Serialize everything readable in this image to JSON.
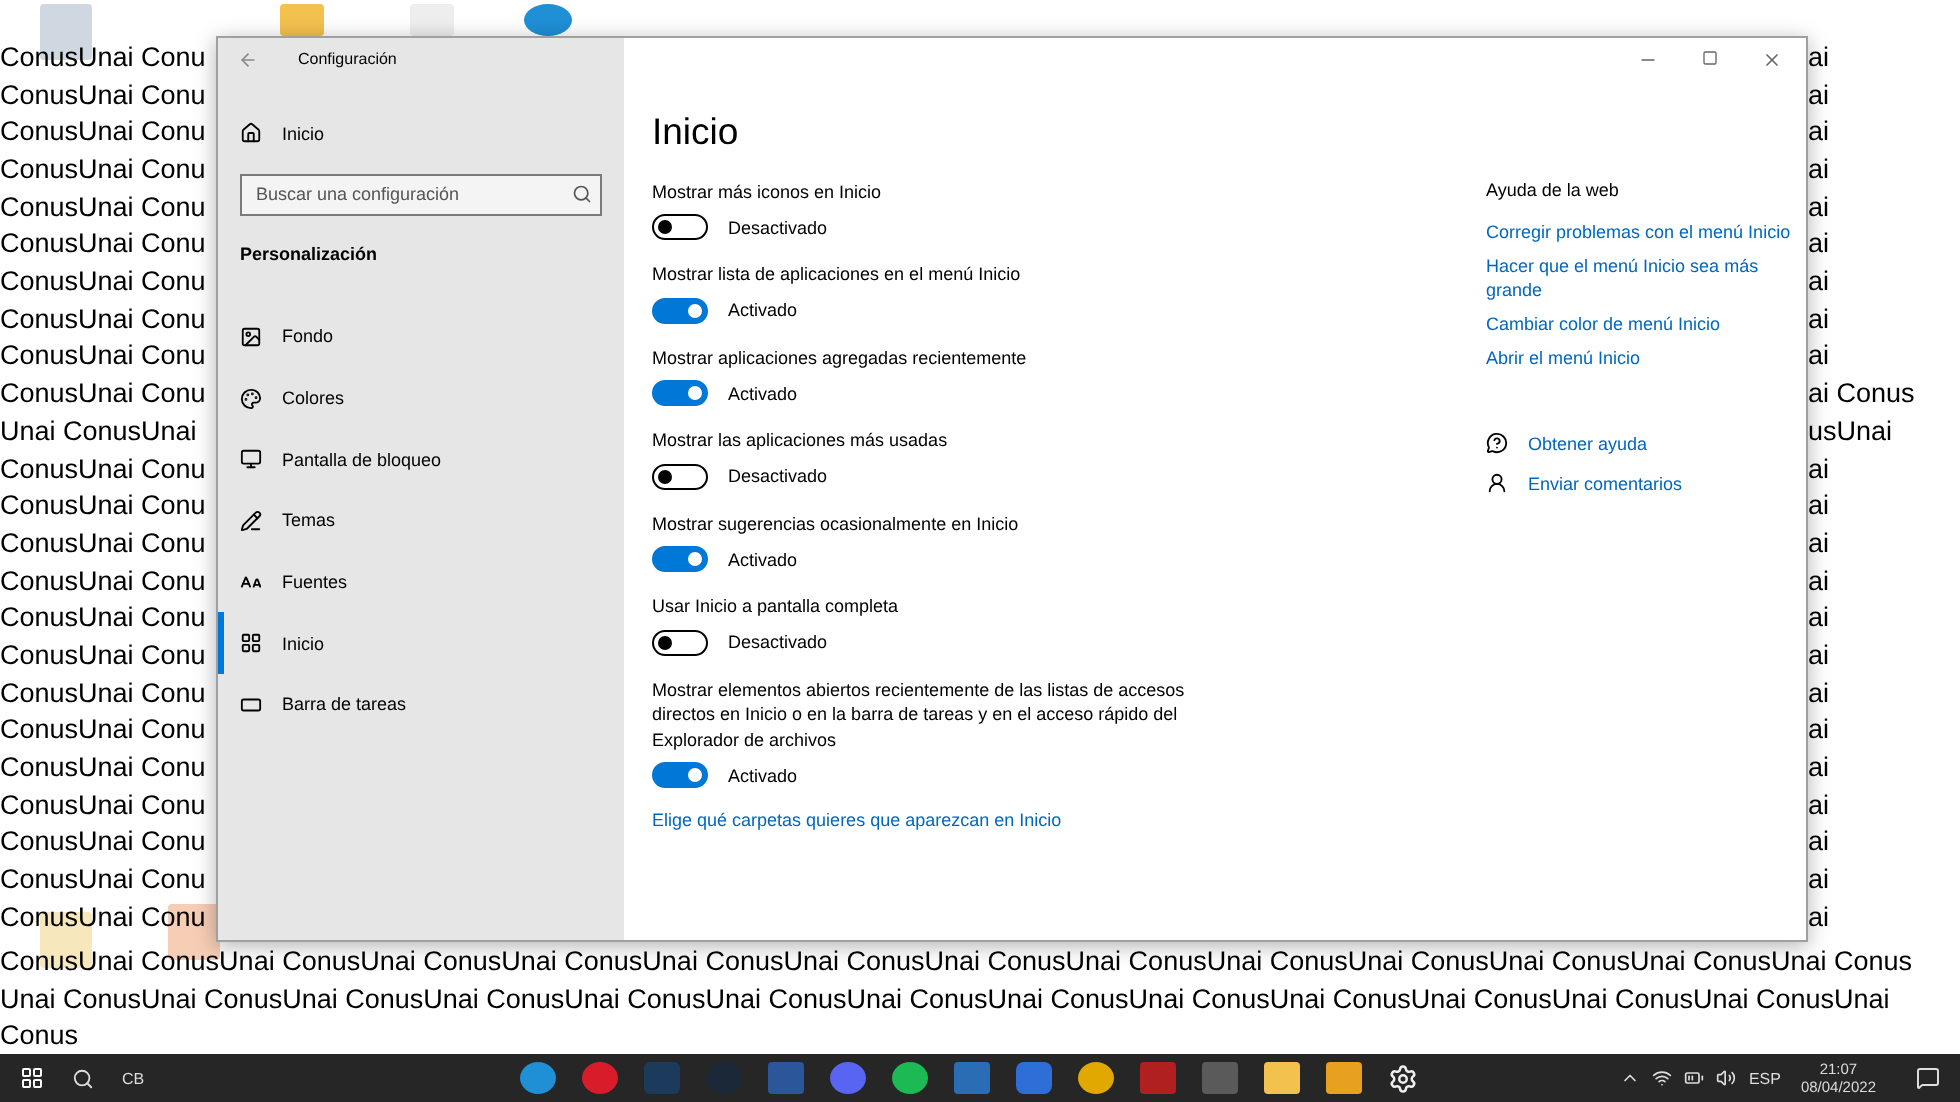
{
  "window": {
    "title": "Configuración"
  },
  "nav": {
    "home": "Inicio",
    "search": {
      "placeholder": "Buscar una configuración"
    },
    "section": "Personalización",
    "items": [
      {
        "label": "Fondo",
        "selected": false
      },
      {
        "label": "Colores",
        "selected": false
      },
      {
        "label": "Pantalla de bloqueo",
        "selected": false
      },
      {
        "label": "Temas",
        "selected": false
      },
      {
        "label": "Fuentes",
        "selected": false
      },
      {
        "label": "Inicio",
        "selected": true
      },
      {
        "label": "Barra de tareas",
        "selected": false
      }
    ]
  },
  "page": {
    "title": "Inicio",
    "settings": [
      {
        "label": "Mostrar más iconos en Inicio",
        "on": false,
        "state": "Desactivado"
      },
      {
        "label": "Mostrar lista de aplicaciones en el menú Inicio",
        "on": true,
        "state": "Activado"
      },
      {
        "label": "Mostrar aplicaciones agregadas recientemente",
        "on": true,
        "state": "Activado"
      },
      {
        "label": "Mostrar las aplicaciones más usadas",
        "on": false,
        "state": "Desactivado"
      },
      {
        "label": "Mostrar sugerencias ocasionalmente en Inicio",
        "on": true,
        "state": "Activado"
      },
      {
        "label": "Usar Inicio a pantalla completa",
        "on": false,
        "state": "Desactivado"
      },
      {
        "label": "Mostrar elementos abiertos recientemente de las listas de accesos directos en Inicio o en la barra de tareas y en el acceso rápido del Explorador de archivos",
        "on": true,
        "state": "Activado"
      }
    ],
    "link": "Elige qué carpetas quieres que aparezcan en Inicio"
  },
  "help": {
    "title": "Ayuda de la web",
    "links": [
      "Corregir problemas con el menú Inicio",
      "Hacer que el menú Inicio sea más grande",
      "Cambiar color de menú Inicio",
      "Abrir el menú Inicio"
    ],
    "actions": [
      {
        "kind": "help",
        "label": "Obtener ayuda"
      },
      {
        "kind": "feedback",
        "label": "Enviar comentarios"
      }
    ]
  },
  "desktop": {
    "wallpaper_left": [
      "ConusUnai Conu",
      "ConusUnai Conu",
      "ConusUnai Conu",
      "ConusUnai Conu",
      "ConusUnai Conu",
      "ConusUnai Conu",
      "ConusUnai Conu",
      "ConusUnai Conu",
      "ConusUnai Conu",
      "ConusUnai Conu",
      "Unai ConusUnai",
      "ConusUnai Conu",
      "ConusUnai Conu",
      "ConusUnai Conu",
      "ConusUnai Conu",
      "ConusUnai Conu",
      "ConusUnai Conu",
      "ConusUnai Conu",
      "ConusUnai Conu",
      "ConusUnai Conu",
      "ConusUnai Conu",
      "ConusUnai Conu",
      "ConusUnai Conu",
      "ConusUnai Conu"
    ],
    "wallpaper_right": [
      "ai",
      "ai",
      "ai",
      "ai",
      "ai",
      "ai",
      "ai",
      "ai",
      "ai",
      "ai Conus",
      "usUnai",
      "ai",
      "ai",
      "ai",
      "ai",
      "ai",
      "ai",
      "ai",
      "ai",
      "ai",
      "ai",
      "ai",
      "ai",
      "ai"
    ],
    "wallpaper_bottom": [
      "ConusUnai ConusUnai ConusUnai ConusUnai ConusUnai ConusUnai ConusUnai ConusUnai ConusUnai ConusUnai ConusUnai ConusUnai ConusUnai Conus",
      "Unai ConusUnai ConusUnai ConusUnai ConusUnai ConusUnai ConusUnai ConusUnai ConusUnai ConusUnai ConusUnai ConusUnai ConusUnai ConusUnai",
      "Conus"
    ]
  },
  "taskbar": {
    "search": "CB",
    "language": "ESP",
    "time": "21:07",
    "date": "08/04/2022"
  }
}
